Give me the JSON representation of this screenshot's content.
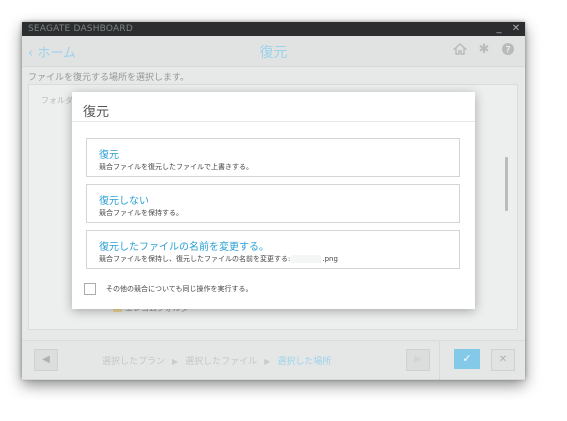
{
  "window": {
    "app_title": "SEAGATE DASHBOARD",
    "minimize_glyph": "_",
    "close_glyph": "✕"
  },
  "header": {
    "back_label": "‹ ホーム",
    "title": "復元",
    "icons": [
      "home-icon",
      "gear-icon",
      "help-icon"
    ]
  },
  "subtitle": "ファイルを復元する場所を選択します。",
  "panel": {
    "folder_label": "フォルダ",
    "folder_item": "エレコムフォルダー"
  },
  "bottom_bar": {
    "steps": [
      "選択したプラン",
      "選択したファイル",
      "選択した場所"
    ],
    "active_step": 2,
    "ok_glyph": "✓",
    "cancel_glyph": "✕"
  },
  "dialog": {
    "title": "復元",
    "options": [
      {
        "title": "復元",
        "description": "競合ファイルを復元したファイルで上書きする。"
      },
      {
        "title": "復元しない",
        "description": "競合ファイルを保持する。"
      },
      {
        "title": "復元したファイルの名前を変更する。",
        "description": "競合ファイルを保持し、復元したファイルの名前を変更する:",
        "suffix": ".png"
      }
    ],
    "apply_all_label": "その他の競合についても同じ操作を実行する。",
    "apply_all_checked": false
  },
  "colors": {
    "accent": "#3aa8db",
    "link": "#5fb6df",
    "titlebar": "#2b2d2f"
  }
}
